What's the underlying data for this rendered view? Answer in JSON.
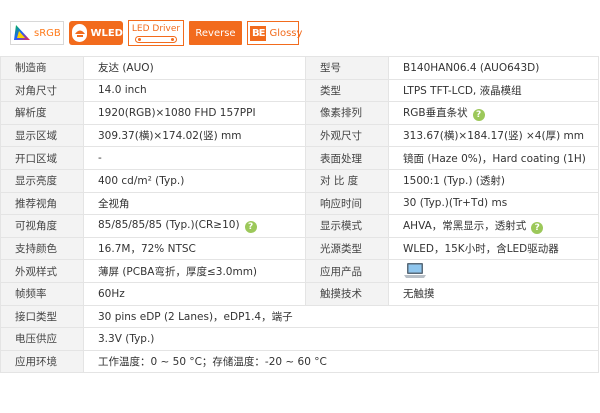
{
  "badges": {
    "srgb": "sRGB",
    "wled": "WLED",
    "led_driver": "LED Driver",
    "reverse": "Reverse",
    "glossy": "Glossy",
    "glossy_mark": "BE"
  },
  "spec": {
    "rows": [
      {
        "k1": "制造商",
        "v1": "友达 (AUO)",
        "k2": "型号",
        "v2": "B140HAN06.4 (AUO643D)"
      },
      {
        "k1": "对角尺寸",
        "v1": "14.0 inch",
        "k2": "类型",
        "v2": "LTPS TFT-LCD, 液晶模组"
      },
      {
        "k1": "解析度",
        "v1": "1920(RGB)×1080   FHD   157PPI",
        "k2": "像素排列",
        "v2": "RGB垂直条状"
      },
      {
        "k1": "显示区域",
        "v1": "309.37(横)×174.02(竖) mm",
        "k2": "外观尺寸",
        "v2": "313.67(横)×184.17(竖) ×4(厚) mm"
      },
      {
        "k1": "开口区域",
        "v1": "-",
        "k2": "表面处理",
        "v2": "镜面 (Haze 0%)，Hard coating (1H)"
      },
      {
        "k1": "显示亮度",
        "v1": "400 cd/m² (Typ.)",
        "k2": "对 比 度",
        "v2": "1500:1 (Typ.) (透射)"
      },
      {
        "k1": "推荐视角",
        "v1": "全视角",
        "k2": "响应时间",
        "v2": "30 (Typ.)(Tr+Td) ms"
      },
      {
        "k1": "可视角度",
        "v1": "85/85/85/85 (Typ.)(CR≥10)",
        "k2": "显示模式",
        "v2": "AHVA，常黑显示，透射式"
      },
      {
        "k1": "支持颜色",
        "v1": "16.7M，72% NTSC",
        "k2": "光源类型",
        "v2": "WLED，15K小时，含LED驱动器"
      },
      {
        "k1": "外观样式",
        "v1": "薄屏 (PCBA弯折，厚度≤3.0mm)",
        "k2": "应用产品",
        "v2": ""
      },
      {
        "k1": "帧频率",
        "v1": "60Hz",
        "k2": "触摸技术",
        "v2": "无触摸"
      },
      {
        "k1": "接口类型",
        "v1": "30 pins   eDP (2 Lanes)，eDP1.4，端子"
      },
      {
        "k1": "电压供应",
        "v1": "3.3V (Typ.)"
      },
      {
        "k1": "应用环境",
        "v1": "工作温度：0 ~ 50 °C；存储温度：-20 ~ 60 °C"
      }
    ]
  }
}
